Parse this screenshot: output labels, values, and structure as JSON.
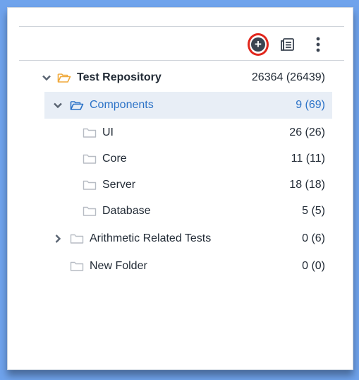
{
  "toolbar": {
    "add_icon": "plus-circle-icon",
    "details_icon": "details-panel-icon",
    "more_icon": "more-vertical-icon",
    "add_glyph": "+"
  },
  "tree": {
    "root": {
      "label": "Test Repository",
      "count": "26364 (26439)"
    },
    "components": {
      "label": "Components",
      "count": "9 (69)"
    },
    "children": [
      {
        "label": "UI",
        "count": "26 (26)"
      },
      {
        "label": "Core",
        "count": "11 (11)"
      },
      {
        "label": "Server",
        "count": "18 (18)"
      },
      {
        "label": "Database",
        "count": "5 (5)"
      }
    ],
    "arithmetic": {
      "label": "Arithmetic Related Tests",
      "count": "0 (6)"
    },
    "new_folder": {
      "label": "New Folder",
      "count": "0 (0)"
    }
  },
  "colors": {
    "selected_bg": "#e8eef6",
    "selected_text": "#2b72c7",
    "highlight_ring": "#e1261c",
    "root_folder": "#f0a93b"
  }
}
